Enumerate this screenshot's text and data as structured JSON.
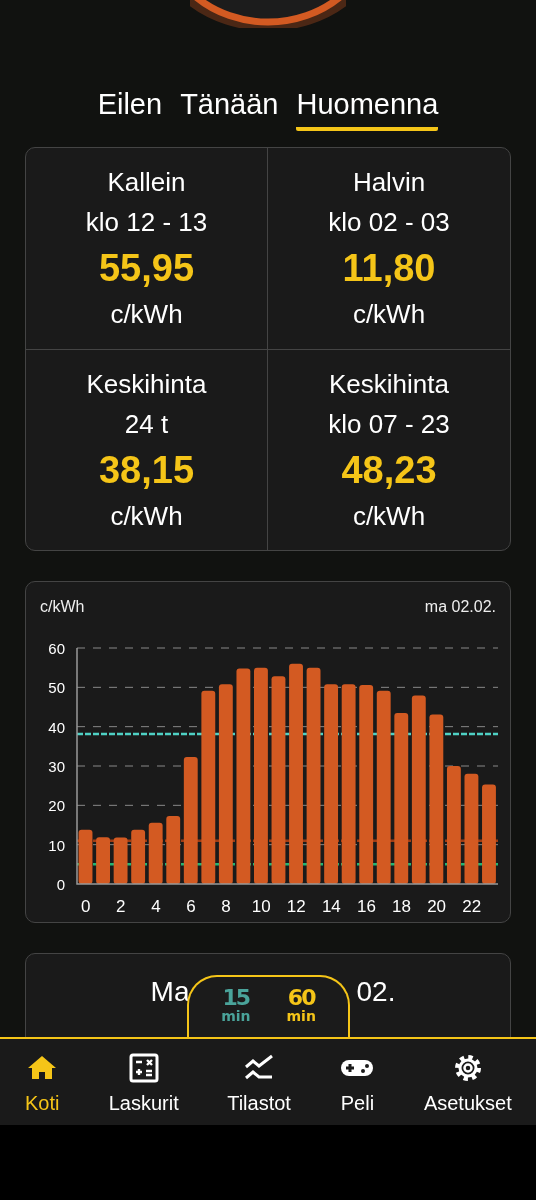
{
  "tabs": [
    {
      "label": "Eilen",
      "selected": false
    },
    {
      "label": "Tänään",
      "selected": false
    },
    {
      "label": "Huomenna",
      "selected": true
    }
  ],
  "stats": [
    {
      "title": "Kallein",
      "period": "klo 12 - 13",
      "value": "55,95",
      "unit": "c/kWh"
    },
    {
      "title": "Halvin",
      "period": "klo 02 - 03",
      "value": "11,80",
      "unit": "c/kWh"
    },
    {
      "title": "Keskihinta",
      "period": "24 t",
      "value": "38,15",
      "unit": "c/kWh"
    },
    {
      "title": "Keskihinta",
      "period": "klo 07 - 23",
      "value": "48,23",
      "unit": "c/kWh"
    }
  ],
  "price_chart": {
    "date": "ma 02.02.",
    "chart_data": {
      "type": "bar",
      "ylabel": "c/kWh",
      "x": [
        0,
        1,
        2,
        3,
        4,
        5,
        6,
        7,
        8,
        9,
        10,
        11,
        12,
        13,
        14,
        15,
        16,
        17,
        18,
        19,
        20,
        21,
        22,
        23
      ],
      "grid": true,
      "xlim": [
        -0.5,
        23.5
      ],
      "series": [
        {
          "color": "#d35a22",
          "values": [
            13.8,
            11.9,
            11.8,
            13.8,
            15.6,
            17.3,
            32.3,
            49.1,
            50.8,
            54.8,
            55.0,
            52.8,
            56.0,
            55.0,
            50.8,
            50.8,
            50.6,
            49.1,
            43.5,
            47.9,
            43.1,
            30.0,
            28.0,
            25.3
          ]
        }
      ],
      "ylim": [
        0,
        60
      ],
      "yticks": [
        0,
        10,
        20,
        30,
        40,
        50,
        60
      ],
      "xticks": [
        0,
        2,
        4,
        6,
        8,
        10,
        12,
        14,
        16,
        18,
        20,
        22
      ],
      "ref_lines": [
        {
          "axis": "y",
          "value": 38.15,
          "color": "#4fd1c5"
        },
        {
          "axis": "y",
          "value": 11,
          "color": "#a03c14"
        },
        {
          "axis": "y",
          "value": 5,
          "color": "#22b573"
        }
      ]
    }
  },
  "day_card": {
    "title_parts": [
      "Ma",
      "02."
    ]
  },
  "interval_toggle": [
    {
      "number": "15",
      "unit": "min",
      "selected": false
    },
    {
      "number": "60",
      "unit": "min",
      "selected": true
    }
  ],
  "nav": [
    {
      "label": "Koti",
      "selected": true
    },
    {
      "label": "Laskurit",
      "selected": false
    },
    {
      "label": "Tilastot",
      "selected": false
    },
    {
      "label": "Peli",
      "selected": false
    },
    {
      "label": "Asetukset",
      "selected": false
    }
  ]
}
